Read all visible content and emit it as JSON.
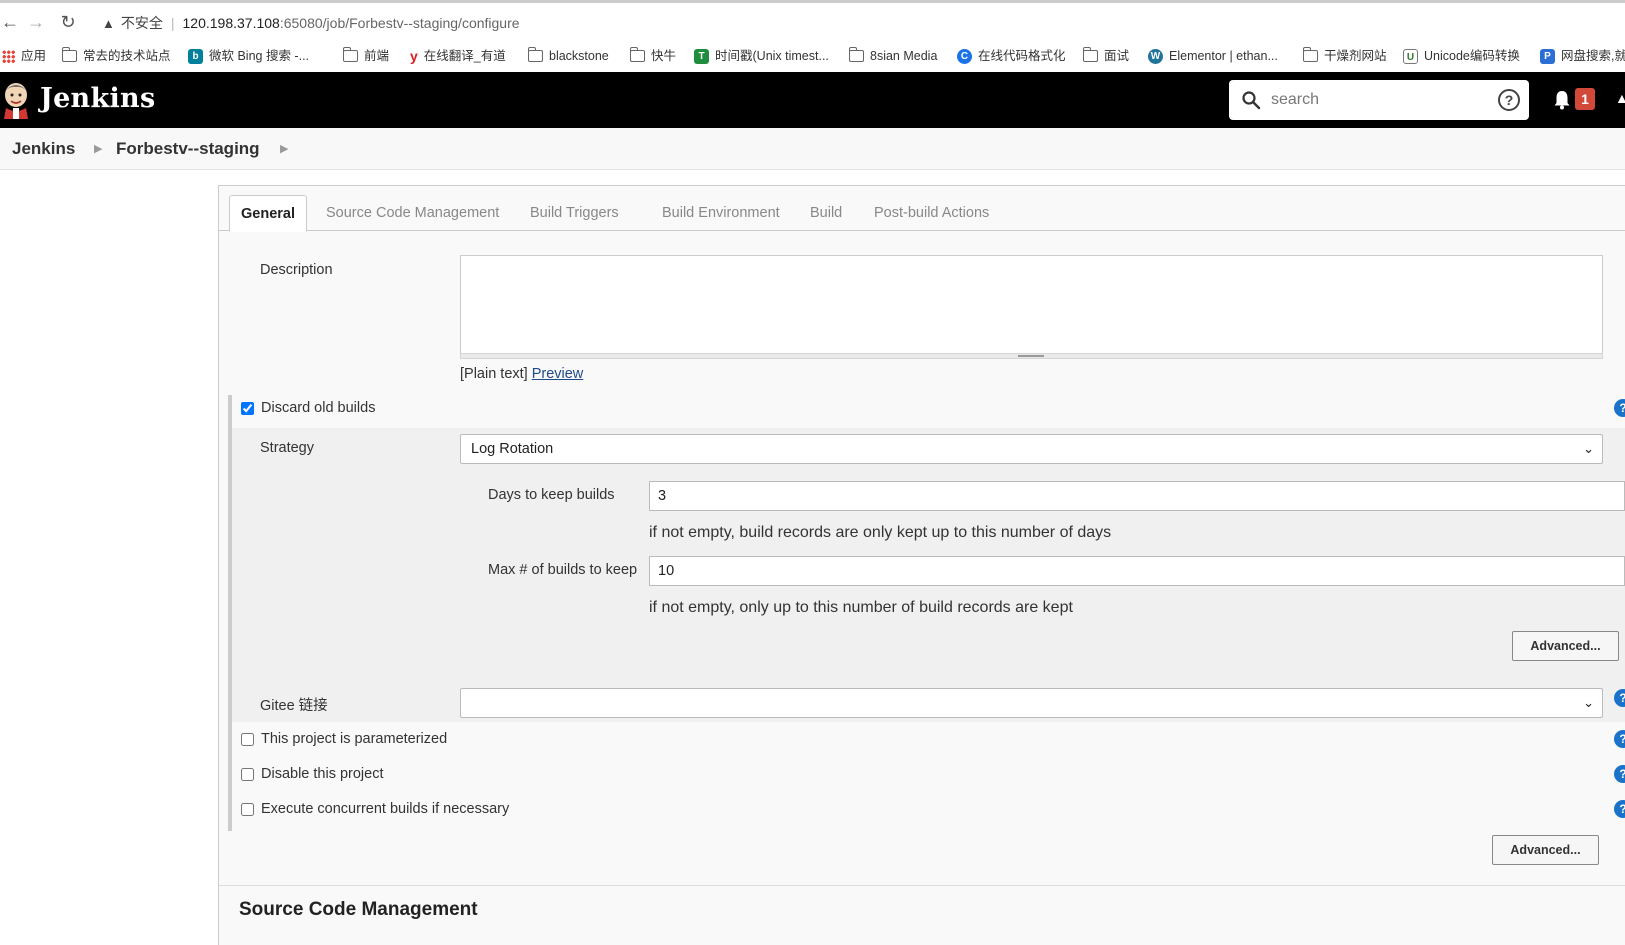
{
  "browser": {
    "insecure_label": "不安全",
    "url_host": "120.198.37.108",
    "url_rest": ":65080/job/Forbestv--staging/configure"
  },
  "bookmarks": [
    {
      "label": "应用",
      "icon": "apps-grid-icon"
    },
    {
      "label": "常去的技术站点",
      "icon": "folder-icon"
    },
    {
      "label": "微软 Bing 搜索 -...",
      "icon": "bing-icon"
    },
    {
      "label": "前端",
      "icon": "folder-icon"
    },
    {
      "label": "在线翻译_有道",
      "icon": "youdao-icon"
    },
    {
      "label": "blackstone",
      "icon": "folder-icon"
    },
    {
      "label": "快牛",
      "icon": "folder-icon"
    },
    {
      "label": "时间戳(Unix timest...",
      "icon": "timestamp-icon"
    },
    {
      "label": "8sian Media",
      "icon": "folder-icon"
    },
    {
      "label": "在线代码格式化",
      "icon": "code-format-icon"
    },
    {
      "label": "面试",
      "icon": "folder-icon"
    },
    {
      "label": "Elementor | ethan...",
      "icon": "wordpress-icon"
    },
    {
      "label": "干燥剂网站",
      "icon": "folder-icon"
    },
    {
      "label": "Unicode编码转换",
      "icon": "unicode-icon"
    },
    {
      "label": "网盘搜索,就",
      "icon": "pan-search-icon"
    }
  ],
  "header": {
    "brand": "Jenkins",
    "search_placeholder": "search",
    "notification_count": "1"
  },
  "breadcrumb": {
    "root": "Jenkins",
    "job": "Forbestv--staging"
  },
  "tabs": [
    {
      "label": "General",
      "active": true
    },
    {
      "label": "Source Code Management",
      "active": false
    },
    {
      "label": "Build Triggers",
      "active": false
    },
    {
      "label": "Build Environment",
      "active": false
    },
    {
      "label": "Build",
      "active": false
    },
    {
      "label": "Post-build Actions",
      "active": false
    }
  ],
  "general": {
    "description_label": "Description",
    "description_value": "",
    "plain_text_label": "[Plain text]",
    "preview_link": "Preview",
    "discard_old_builds": {
      "label": "Discard old builds",
      "checked": true
    },
    "strategy_label": "Strategy",
    "strategy_value": "Log Rotation",
    "days_to_keep_label": "Days to keep builds",
    "days_to_keep_value": "3",
    "days_to_keep_hint": "if not empty, build records are only kept up to this number of days",
    "max_builds_label": "Max # of builds to keep",
    "max_builds_value": "10",
    "max_builds_hint": "if not empty, only up to this number of build records are kept",
    "advanced_button": "Advanced...",
    "gitee_label": "Gitee 链接",
    "gitee_value": "",
    "parameterized": {
      "label": "This project is parameterized",
      "checked": false
    },
    "disable_project": {
      "label": "Disable this project",
      "checked": false
    },
    "concurrent_builds": {
      "label": "Execute concurrent builds if necessary",
      "checked": false
    },
    "advanced_button_2": "Advanced..."
  },
  "next_section": {
    "heading": "Source Code Management"
  },
  "colors": {
    "header_bg": "#000000",
    "badge": "#d24939",
    "help_icon": "#1a73c9",
    "link": "#204a87"
  }
}
